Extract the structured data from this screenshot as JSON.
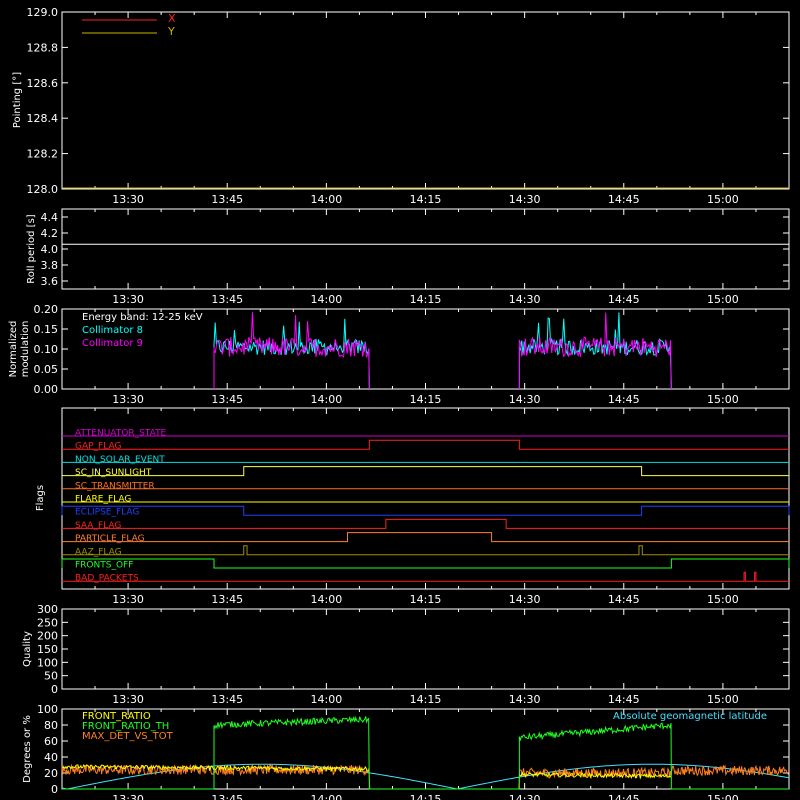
{
  "time_ticks": [
    "13:30",
    "13:45",
    "14:00",
    "14:15",
    "14:30",
    "14:45",
    "15:00"
  ],
  "time_range_min": [
    800,
    910
  ],
  "panels": {
    "pointing": {
      "ylabel": "Pointing [°]",
      "ylim": [
        128.0,
        129.0
      ],
      "yticks": [
        "128.0",
        "128.2",
        "128.4",
        "128.6",
        "128.8",
        "129.0"
      ],
      "legend": [
        {
          "name": "X",
          "color": "#ff2020"
        },
        {
          "name": "Y",
          "color": "#c8b400"
        }
      ]
    },
    "roll": {
      "ylabel": "Roll period [s]",
      "ylim": [
        3.5,
        4.5
      ],
      "yticks": [
        "3.6",
        "3.8",
        "4.0",
        "4.2",
        "4.4"
      ]
    },
    "modulation": {
      "ylabel_line1": "Normalized",
      "ylabel_line2": "modulation",
      "ylim": [
        0,
        0.2
      ],
      "yticks": [
        "0.00",
        "0.05",
        "0.10",
        "0.15",
        "0.20"
      ],
      "annotation": "Energy band: 12-25 keV",
      "legend": [
        {
          "name": "Collimator 8",
          "color": "#00ffff"
        },
        {
          "name": "Collimator 9",
          "color": "#ff00ff"
        }
      ]
    },
    "flags": {
      "ylabel": "Flags",
      "items": [
        {
          "name": "ATTENUATOR_STATE",
          "color": "#d000d0"
        },
        {
          "name": "GAP_FLAG",
          "color": "#ff2020"
        },
        {
          "name": "NON_SOLAR_EVENT",
          "color": "#00e0e0"
        },
        {
          "name": "SC_IN_SUNLIGHT",
          "color": "#ffff40"
        },
        {
          "name": "SC_TRANSMITTER",
          "color": "#ff7020"
        },
        {
          "name": "FLARE_FLAG",
          "color": "#ffff00"
        },
        {
          "name": "ECLIPSE_FLAG",
          "color": "#2040ff"
        },
        {
          "name": "SAA_FLAG",
          "color": "#ff2020"
        },
        {
          "name": "PARTICLE_FLAG",
          "color": "#ff8030"
        },
        {
          "name": "AAZ_FLAG",
          "color": "#a09000"
        },
        {
          "name": "FRONTS_OFF",
          "color": "#20ff20"
        },
        {
          "name": "BAD_PACKETS",
          "color": "#ff2020"
        }
      ]
    },
    "quality": {
      "ylabel": "Quality",
      "ylim": [
        0,
        300
      ],
      "yticks": [
        "0",
        "50",
        "100",
        "150",
        "200",
        "250",
        "300"
      ]
    },
    "ratios": {
      "ylabel": "Degrees or %",
      "ylim": [
        0,
        100
      ],
      "yticks": [
        "0",
        "20",
        "40",
        "60",
        "80",
        "100"
      ],
      "legend": [
        {
          "name": "FRONT_RATIO",
          "color": "#ffff00"
        },
        {
          "name": "FRONT_RATIO_TH",
          "color": "#20ff20"
        },
        {
          "name": "MAX_DET_VS_TOT",
          "color": "#ff8020"
        }
      ],
      "annotation": "Absolute geomagnetic latitude",
      "annotation_color": "#40e0ff"
    }
  },
  "chart_data": {
    "type": "line",
    "x_unit": "minutes",
    "series": [
      {
        "panel": "pointing",
        "name": "X",
        "values": [
          [
            800,
            128.0
          ],
          [
            910,
            128.0
          ]
        ]
      },
      {
        "panel": "pointing",
        "name": "Y",
        "values": [
          [
            800,
            128.0
          ],
          [
            910,
            128.0
          ]
        ]
      },
      {
        "panel": "roll",
        "values": [
          [
            800,
            4.06
          ],
          [
            910,
            4.06
          ]
        ]
      },
      {
        "panel": "modulation",
        "name": "Collimator 8",
        "segments": [
          [
            823.0,
            846.5
          ],
          [
            869.2,
            892.2
          ]
        ],
        "mean": 0.105,
        "noise": 0.02
      },
      {
        "panel": "modulation",
        "name": "Collimator 9",
        "segments": [
          [
            823.0,
            846.5
          ],
          [
            869.2,
            892.2
          ]
        ],
        "mean": 0.105,
        "noise": 0.025
      },
      {
        "panel": "quality",
        "values": [
          [
            800,
            0
          ],
          [
            910,
            0
          ]
        ]
      }
    ],
    "flag_steps": [
      {
        "flag": "ATTENUATOR_STATE",
        "high": []
      },
      {
        "flag": "GAP_FLAG",
        "high": [
          [
            846.5,
            869.2
          ]
        ]
      },
      {
        "flag": "NON_SOLAR_EVENT",
        "high": []
      },
      {
        "flag": "SC_IN_SUNLIGHT",
        "high": [
          [
            827.5,
            887.7
          ]
        ]
      },
      {
        "flag": "SC_TRANSMITTER",
        "high": []
      },
      {
        "flag": "FLARE_FLAG",
        "high": []
      },
      {
        "flag": "ECLIPSE_FLAG",
        "high": [
          [
            800,
            827.5
          ],
          [
            887.7,
            910
          ]
        ]
      },
      {
        "flag": "SAA_FLAG",
        "high": [
          [
            849.0,
            867.2
          ]
        ]
      },
      {
        "flag": "PARTICLE_FLAG",
        "high": [
          [
            843.2,
            865.0
          ]
        ]
      },
      {
        "flag": "AAZ_FLAG",
        "high": [
          [
            827.5,
            828.0
          ],
          [
            887.3,
            887.8
          ]
        ]
      },
      {
        "flag": "FRONTS_OFF",
        "high": [
          [
            800,
            823.0
          ],
          [
            892.2,
            910
          ]
        ]
      },
      {
        "flag": "BAD_PACKETS",
        "high": [
          [
            903.2,
            903.4
          ],
          [
            904.8,
            905.0
          ]
        ]
      }
    ],
    "ratio_series": [
      {
        "name": "FRONT_RATIO_TH",
        "segments": [
          [
            823.0,
            846.5,
            80,
            87
          ],
          [
            869.2,
            892.2,
            64,
            80
          ]
        ],
        "base": 0
      },
      {
        "name": "FRONT_RATIO",
        "segments": [
          [
            800,
            846.5,
            28,
            25
          ],
          [
            869.2,
            892.2,
            18,
            16
          ]
        ]
      },
      {
        "name": "MAX_DET_VS_TOT",
        "level_low": 24,
        "level_high": 20
      }
    ],
    "latitude": {
      "minima_at": [
        800.8,
        859.8
      ],
      "peak": 31,
      "period_min": 95
    }
  }
}
